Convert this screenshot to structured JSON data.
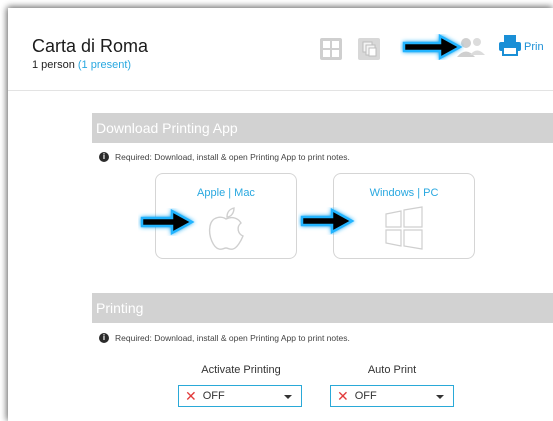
{
  "header": {
    "title": "Carta di Roma",
    "count_text": "1 person",
    "present_text": "(1 present)",
    "print_label": "Prin"
  },
  "download_section": {
    "heading": "Download Printing App",
    "note": "Required: Download, install & open Printing App to print notes.",
    "mac_label": "Apple | Mac",
    "windows_label": "Windows | PC"
  },
  "printing_section": {
    "heading": "Printing",
    "note": "Required: Download, install & open Printing App to print notes.",
    "activate_label": "Activate Printing",
    "activate_value": "OFF",
    "auto_label": "Auto Print",
    "auto_value": "OFF"
  },
  "colors": {
    "accent": "#29a8e0",
    "section_bar": "#d2d2d2",
    "off_x": "#e23b3b"
  }
}
